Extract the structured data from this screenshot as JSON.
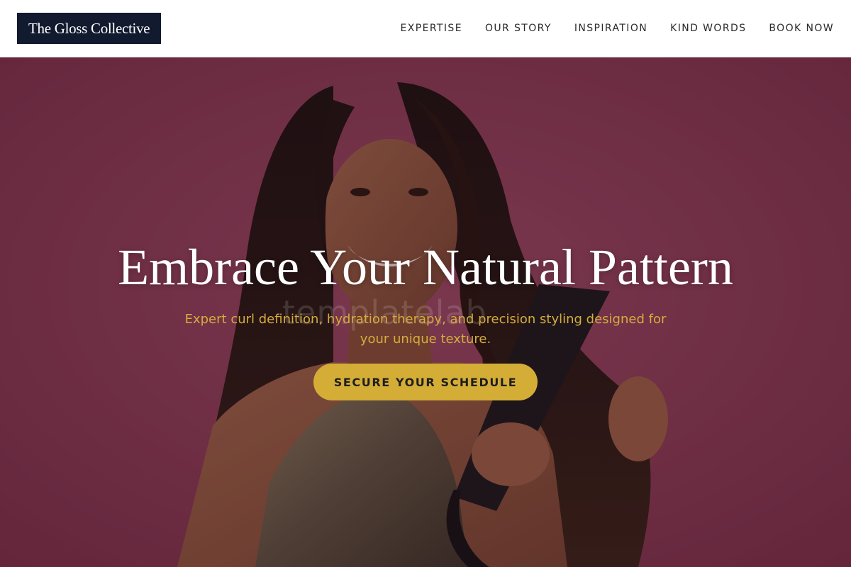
{
  "header": {
    "logo_text": "The Gloss Collective",
    "nav": [
      {
        "label": "EXPERTISE"
      },
      {
        "label": "OUR STORY"
      },
      {
        "label": "INSPIRATION"
      },
      {
        "label": "KIND WORDS"
      },
      {
        "label": "BOOK NOW"
      }
    ]
  },
  "hero": {
    "title": "Embrace Your Natural Pattern",
    "subtitle": "Expert curl definition, hydration therapy, and precision styling designed for your unique texture.",
    "cta_label": "SECURE YOUR SCHEDULE",
    "watermark": "templatelab"
  },
  "colors": {
    "logo_background": "#121a2f",
    "hero_background": "#8a3d55",
    "accent_gold": "#d4ad37",
    "subtitle_gold": "#d4ad3c"
  },
  "icons": {
    "hero_image": "smiling-woman-straightening-hair-photo"
  }
}
